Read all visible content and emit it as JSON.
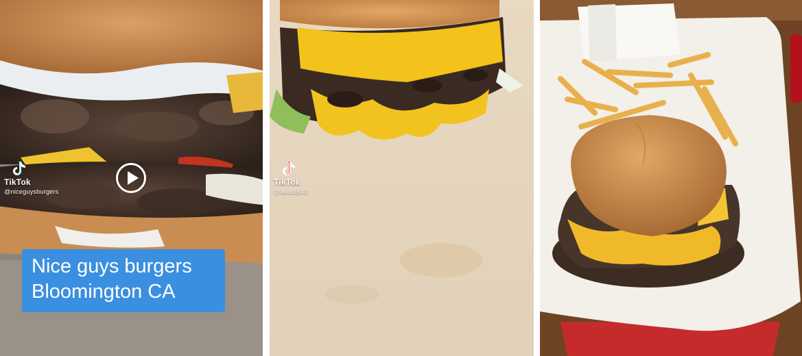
{
  "panels": [
    {
      "tiktok_brand": "TikTok",
      "tiktok_user": "@niceguysburgers",
      "caption_line1": "Nice guys burgers",
      "caption_line2": "Bloomington CA",
      "icons": [
        "tiktok-logo-icon",
        "play-icon"
      ]
    },
    {
      "tiktok_brand": "TikTok",
      "tiktok_user": "@akra5543",
      "icons": [
        "tiktok-logo-icon",
        "play-icon"
      ]
    },
    {
      "description_free": true
    }
  ],
  "colors": {
    "caption_bg": "#3b8fe0",
    "play_ring": "#ffffff"
  }
}
